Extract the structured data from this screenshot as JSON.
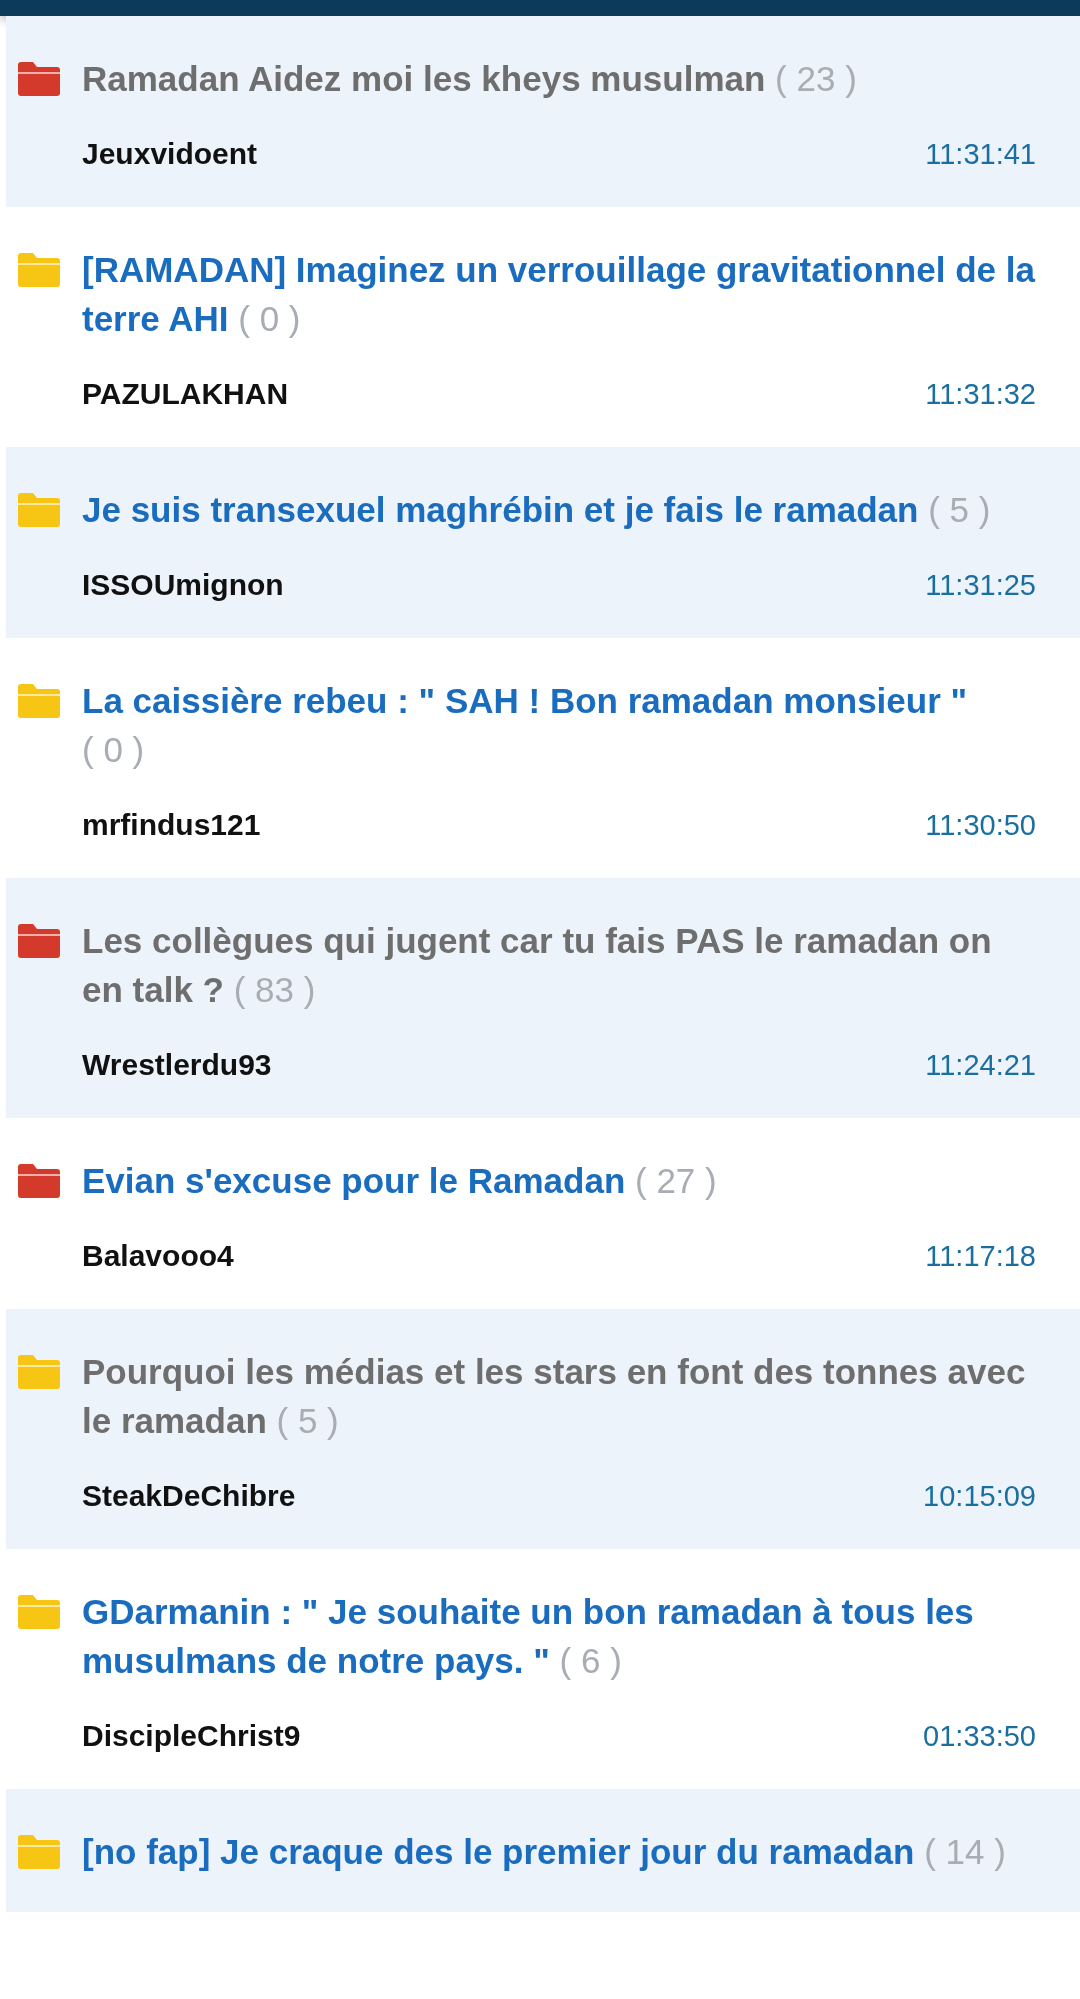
{
  "topics": [
    {
      "title": "Ramadan Aidez moi les kheys musulman",
      "count": "( 23 )",
      "hot": true,
      "read": true,
      "author": "Jeuxvidoent",
      "time": "11:31:41"
    },
    {
      "title": "[RAMADAN] Imaginez un verrouillage gravitationnel de la terre AHI",
      "count": "( 0 )",
      "hot": false,
      "read": false,
      "author": "PAZULAKHAN",
      "time": "11:31:32"
    },
    {
      "title": "Je suis transexuel maghrébin et je fais le ramadan",
      "count": "( 5 )",
      "hot": false,
      "read": false,
      "author": "ISSOUmignon",
      "time": "11:31:25"
    },
    {
      "title": "La caissière rebeu : \" SAH ! Bon ramadan monsieur \"",
      "count": "( 0 )",
      "hot": false,
      "read": false,
      "author": "mrfindus121",
      "time": "11:30:50"
    },
    {
      "title": "Les collègues qui jugent car tu fais PAS le ramadan on en talk ?",
      "count": "( 83 )",
      "hot": true,
      "read": true,
      "author": "Wrestlerdu93",
      "time": "11:24:21"
    },
    {
      "title": "Evian s'excuse pour le Ramadan",
      "count": "( 27 )",
      "hot": true,
      "read": false,
      "author": "Balavooo4",
      "time": "11:17:18"
    },
    {
      "title": "Pourquoi les médias et les stars en font des tonnes avec le ramadan",
      "count": "( 5 )",
      "hot": false,
      "read": true,
      "author": "SteakDeChibre",
      "time": "10:15:09"
    },
    {
      "title": "GDarmanin : \" Je souhaite un bon ramadan à tous les musulmans de notre pays. \"",
      "count": "( 6 )",
      "hot": false,
      "read": false,
      "author": "DiscipleChrist9",
      "time": "01:33:50"
    },
    {
      "title": "[no fap] Je craque des le premier jour du ramadan",
      "count": "( 14 )",
      "hot": false,
      "read": false
    }
  ]
}
